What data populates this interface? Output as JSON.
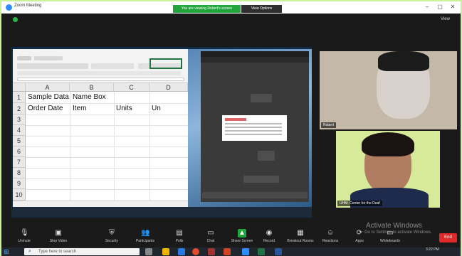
{
  "window": {
    "title": "Zoom Meeting",
    "banner": "You are viewing Robert's screen",
    "view_options": "View Options",
    "controls": {
      "minimize": "–",
      "maximize": "▢",
      "close": "✕"
    },
    "top_view_label": "View"
  },
  "spreadsheet": {
    "columns": [
      "A",
      "B",
      "C",
      "D"
    ],
    "rows": [
      "1",
      "2",
      "3",
      "4",
      "5",
      "6",
      "7",
      "8",
      "9",
      "10"
    ],
    "cells": {
      "A1": "Sample Data",
      "B1": "Name Box",
      "A2": "Order Date",
      "B2": "Item",
      "C2": "Units",
      "D2": "Un"
    }
  },
  "participants": [
    {
      "name": "Robert"
    },
    {
      "name": "UHM: Center for the Deaf"
    }
  ],
  "watermark": {
    "line1": "Activate Windows",
    "line2": "Go to Settings to activate Windows."
  },
  "meeting_controls": [
    {
      "label": "Unmute",
      "icon": "mic-muted-icon",
      "glyph": "🎙"
    },
    {
      "label": "Stop Video",
      "icon": "video-icon",
      "glyph": "▣"
    },
    {
      "label": "Security",
      "icon": "shield-icon",
      "glyph": "⛨"
    },
    {
      "label": "Participants",
      "icon": "participants-icon",
      "glyph": "👥"
    },
    {
      "label": "Polls",
      "icon": "polls-icon",
      "glyph": "▤"
    },
    {
      "label": "Chat",
      "icon": "chat-icon",
      "glyph": "▭"
    },
    {
      "label": "Share Screen",
      "icon": "share-screen-icon",
      "glyph": "▲"
    },
    {
      "label": "Record",
      "icon": "record-icon",
      "glyph": "◉"
    },
    {
      "label": "Breakout Rooms",
      "icon": "breakout-rooms-icon",
      "glyph": "▦"
    },
    {
      "label": "Reactions",
      "icon": "reactions-icon",
      "glyph": "☺"
    },
    {
      "label": "Apps",
      "icon": "apps-icon",
      "glyph": "⟳"
    },
    {
      "label": "Whiteboards",
      "icon": "whiteboards-icon",
      "glyph": "▭"
    }
  ],
  "end_button": "End",
  "taskbar": {
    "search_placeholder": "Type here to search",
    "time": "3:22 PM"
  },
  "colors": {
    "zoom_blue": "#2d8cff",
    "viewing_green": "#23a53d",
    "end_red": "#e02828",
    "excel_green": "#217346"
  }
}
